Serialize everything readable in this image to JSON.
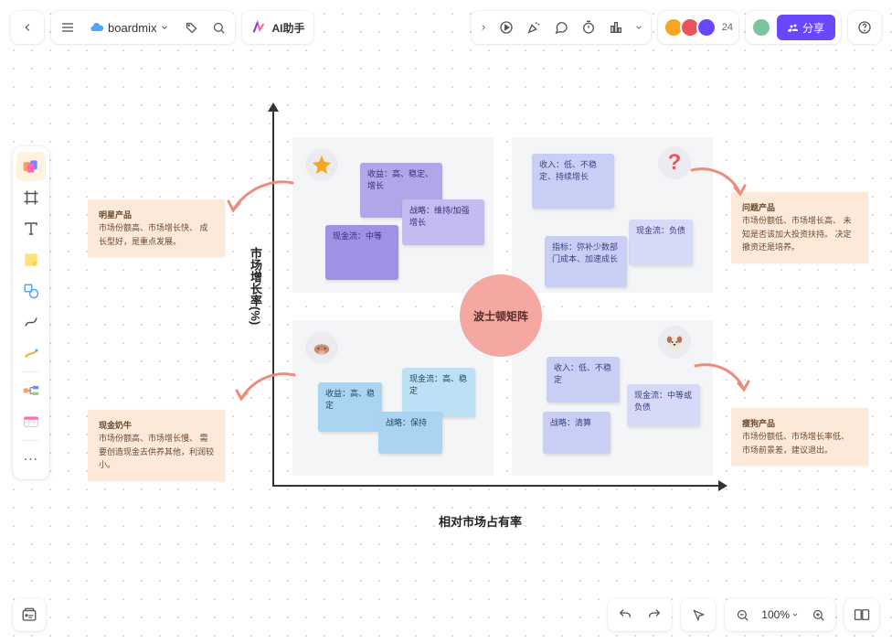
{
  "header": {
    "file_name": "boardmix",
    "ai_label": "AI助手",
    "avatar_count": "24",
    "share_label": "分享"
  },
  "zoom": "100%",
  "diagram": {
    "center_label": "波士顿矩阵",
    "y_axis_label": "市场增长率(%)",
    "x_axis_label": "相对市场占有率",
    "badges": {
      "star": "⭐",
      "question": "?",
      "cow": "🐮",
      "dog": "🐶"
    },
    "q1": {
      "n1": "收益：高、稳定、增长",
      "n2": "战略：维持/加强增长",
      "n3": "现金流：中等"
    },
    "q2": {
      "n1": "收入：低、不稳定、持续增长",
      "n2": "现金流：负债",
      "n3": "指标：弥补少数部门成本、加速成长"
    },
    "q3": {
      "n1": "收益：高、稳定",
      "n2": "现金流：高、稳定",
      "n3": "战略：保持"
    },
    "q4": {
      "n1": "收入：低、不稳定",
      "n2": "现金流：中等或负债",
      "n3": "战略：清算"
    },
    "annotations": {
      "tl": {
        "title": "明星产品",
        "body": "市场份额高、市场增长快、\n成长型好，是重点发展。"
      },
      "bl": {
        "title": "现金奶牛",
        "body": "市场份额高、市场增长慢、\n需要创造现金去供养其他，利润较小。"
      },
      "tr": {
        "title": "问题产品",
        "body": "市场份额低、市场增长高、\n未知是否该加大投资扶持。\n决定撤资还是培养。"
      },
      "br": {
        "title": "瘦狗产品",
        "body": "市场份额低、市场增长率低、\n市场前景差，建议退出。"
      }
    }
  }
}
